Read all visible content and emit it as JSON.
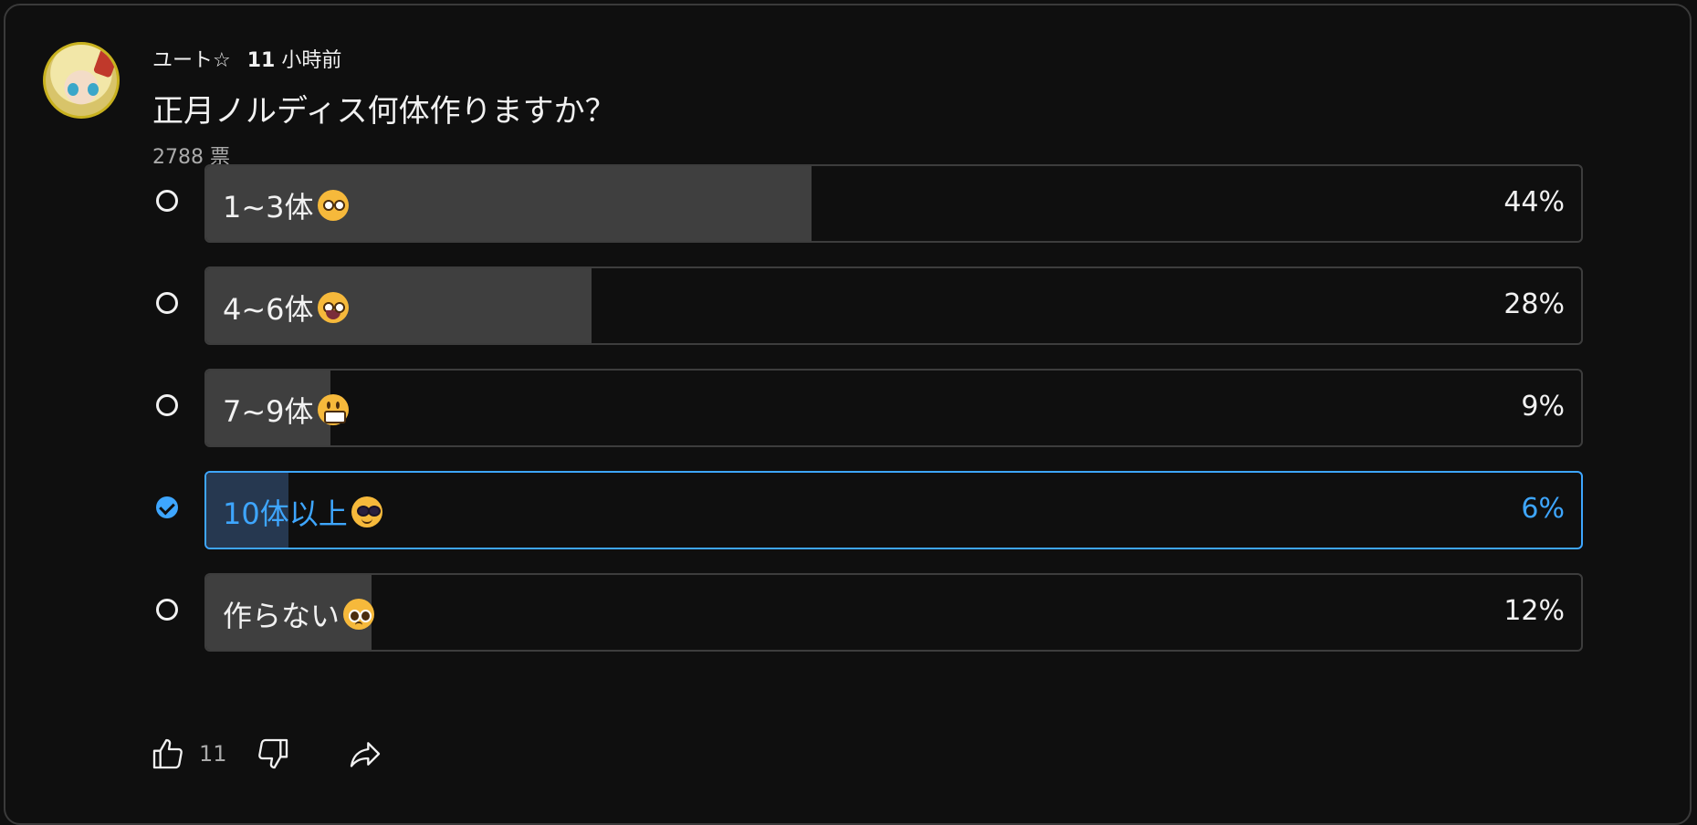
{
  "post": {
    "author": "ユート☆",
    "time_number": "11",
    "time_unit": "小時前",
    "question": "正月ノルディス何体作りますか？",
    "votes": "2788 票"
  },
  "options": [
    {
      "label": "1~3体",
      "emoji": "flushed-face-icon",
      "percent": "44%",
      "fill_percent": 44,
      "selected": false
    },
    {
      "label": "4~6体",
      "emoji": "grinning-face-icon",
      "percent": "28%",
      "fill_percent": 28,
      "selected": false
    },
    {
      "label": "7~9体",
      "emoji": "beaming-face-icon",
      "percent": "9%",
      "fill_percent": 9,
      "selected": false
    },
    {
      "label": "10体以上",
      "emoji": "sunglasses-face-icon",
      "percent": "6%",
      "fill_percent": 6,
      "selected": true
    },
    {
      "label": "作らない",
      "emoji": "pleading-face-icon",
      "percent": "12%",
      "fill_percent": 12,
      "selected": false
    }
  ],
  "actions": {
    "like_count": "11"
  },
  "colors": {
    "background": "#0f0f0f",
    "accent": "#3ea6ff",
    "bar_fill": "#3f3f3f",
    "selected_fill": "#263850",
    "muted_text": "#aaaaaa"
  }
}
